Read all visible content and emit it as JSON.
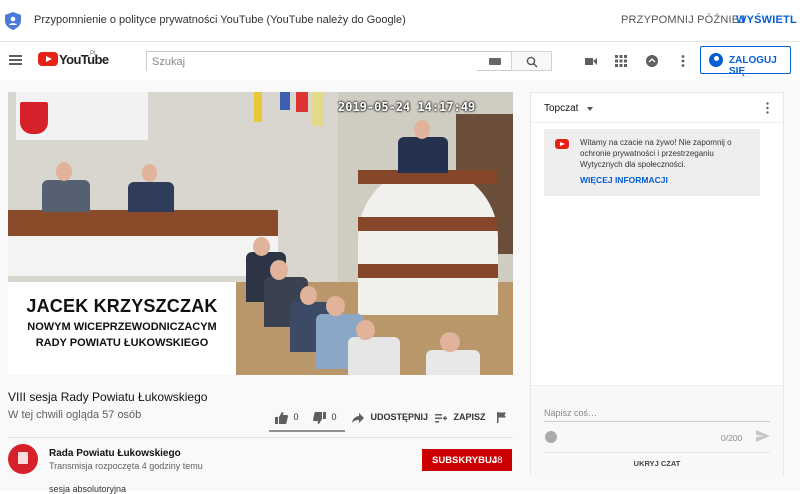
{
  "banner": {
    "message": "Przypomnienie o polityce prywatności YouTube (YouTube należy do Google)",
    "later_label": "PRZYPOMNIJ PÓŹNIEJ",
    "view_label": "WYŚWIETL"
  },
  "masthead": {
    "logo_text": "YouTube",
    "logo_country": "PL",
    "search_placeholder": "Szukaj",
    "signin_label": "ZALOGUJ SIĘ",
    "icons": [
      "menu-icon",
      "video-camera-icon",
      "apps-grid-icon",
      "messages-icon",
      "more-vert-icon"
    ]
  },
  "video": {
    "timestamp": "2019-05-24 14:17:49",
    "caption_name": "JACEK KRZYSZCZAK",
    "caption_line2": "NOWYM WICEPRZEWODNICZACYM",
    "caption_line3": "RADY POWIATU ŁUKOWSKIEGO",
    "title": "VIII sesja Rady Powiatu Łukowskiego",
    "viewers": "W tej chwili ogląda 57 osób",
    "likes": "0",
    "dislikes": "0",
    "share_label": "UDOSTĘPNIJ",
    "save_label": "ZAPISZ"
  },
  "channel": {
    "name": "Rada Powiatu Łukowskiego",
    "subtitle": "Transmisja rozpoczęta 4 godziny temu",
    "subscribe_label": "SUBSKRYBUJ",
    "subscriber_count": "48",
    "description_preview": "sesja absolutoryjna"
  },
  "chat": {
    "header": "Topczat",
    "welcome_text": "Witamy na czacie na żywo! Nie zapomnij o ochronie prywatności i przestrzeganiu Wytycznych dla społeczności.",
    "more_info_label": "WIĘCEJ INFORMACJI",
    "input_placeholder": "Napisz coś…",
    "char_count": "0/200",
    "hide_label": "UKRYJ CZAT"
  },
  "colors": {
    "accent_blue": "#065fd4",
    "youtube_red": "#e62117",
    "subscribe_red": "#cc0000"
  }
}
